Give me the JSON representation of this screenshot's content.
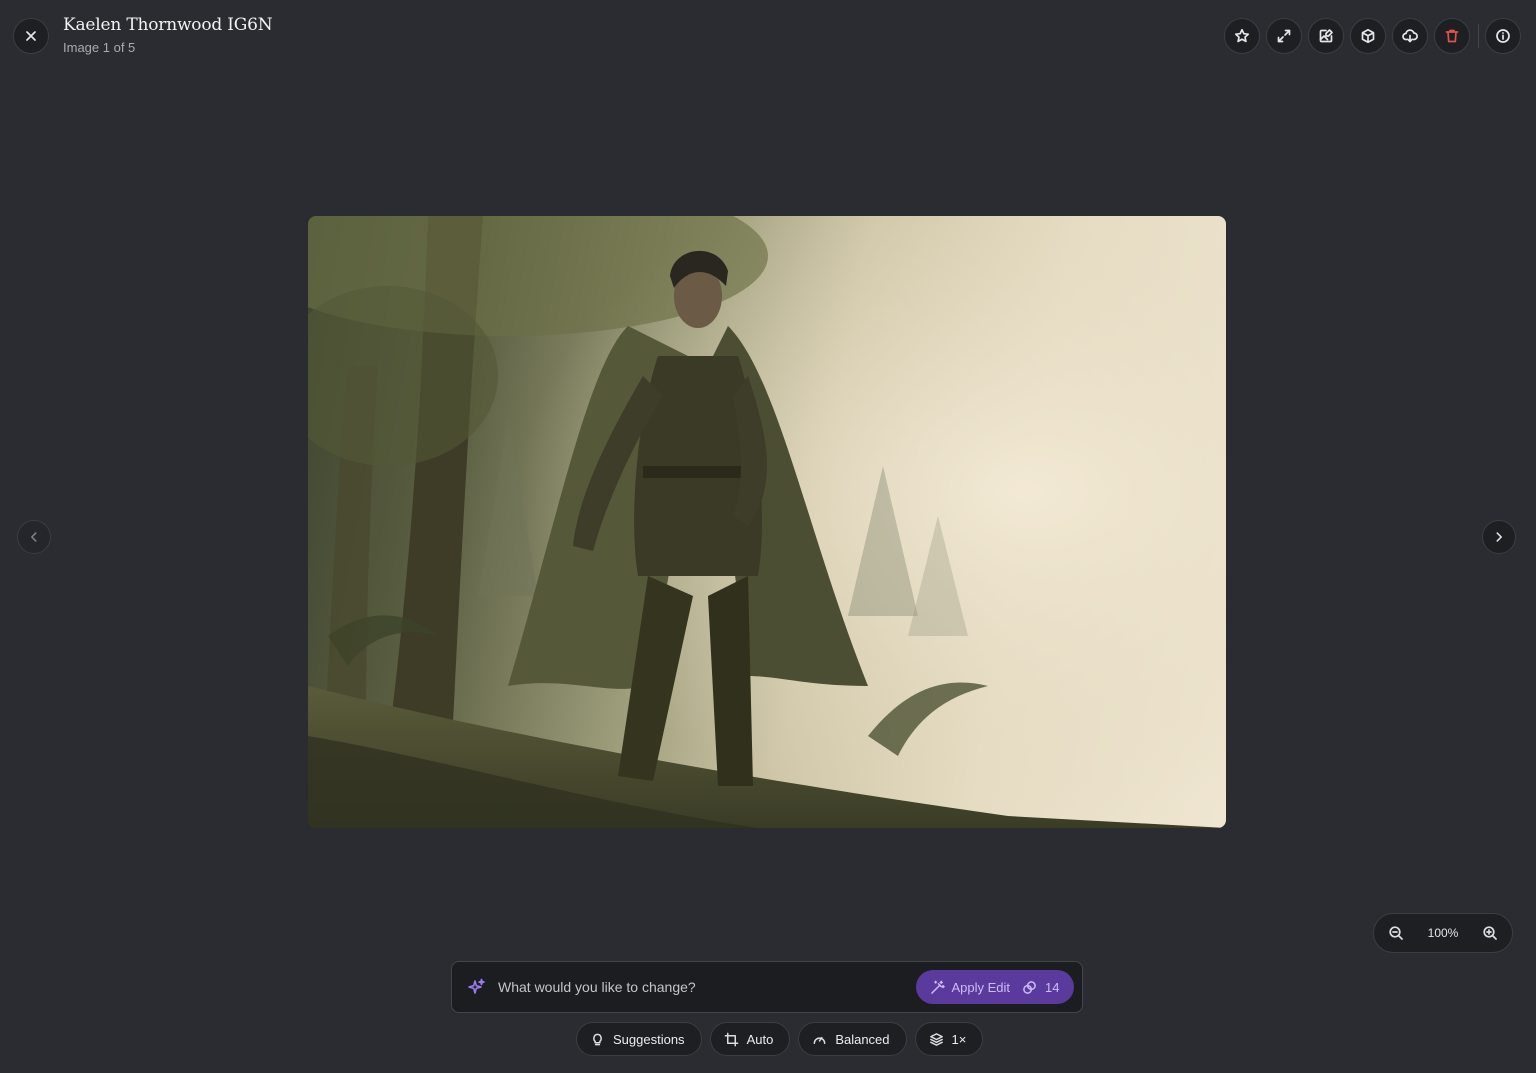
{
  "header": {
    "title": "Kaelen Thornwood IG6N",
    "subtitle": "Image 1 of 5",
    "actions": [
      {
        "name": "favorite",
        "icon": "star-icon"
      },
      {
        "name": "expand",
        "icon": "expand-icon"
      },
      {
        "name": "image-edit",
        "icon": "image-edit-icon"
      },
      {
        "name": "3d-model",
        "icon": "cube-icon"
      },
      {
        "name": "download",
        "icon": "download-icon"
      },
      {
        "name": "delete",
        "icon": "trash-icon",
        "color": "#e0524f"
      },
      {
        "name": "info",
        "icon": "info-icon"
      }
    ]
  },
  "zoom": {
    "level": "100%"
  },
  "prompt": {
    "placeholder": "What would you like to change?",
    "apply_label": "Apply Edit",
    "credits": "14",
    "accent": "#5b3a9e"
  },
  "chips": {
    "suggestions": "Suggestions",
    "auto": "Auto",
    "balanced": "Balanced",
    "count": "1×"
  }
}
